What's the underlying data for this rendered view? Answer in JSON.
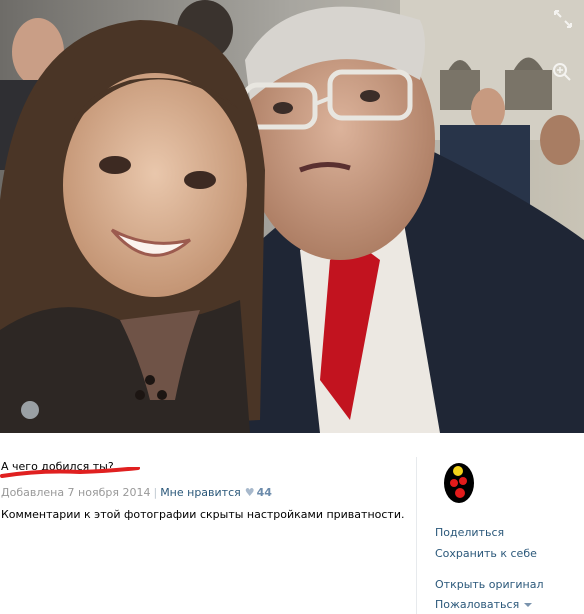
{
  "photo": {
    "expand_icon": "expand-arrows-icon",
    "zoom_icon": "zoom-in-icon"
  },
  "caption": "А чего добился ты?",
  "meta": {
    "added": "Добавлена 7 ноября 2014",
    "separator": "|",
    "like_label": "Мне нравится",
    "like_count": "44"
  },
  "privacy_note": "Комментарии к этой фотографии скрыты настройками приватности.",
  "actions": {
    "share": "Поделиться",
    "save": "Сохранить к себе",
    "open_original": "Открыть оригинал",
    "report": "Пожаловаться"
  },
  "colors": {
    "link": "#2b587a",
    "meta": "#999999",
    "underline": "#e02020"
  }
}
